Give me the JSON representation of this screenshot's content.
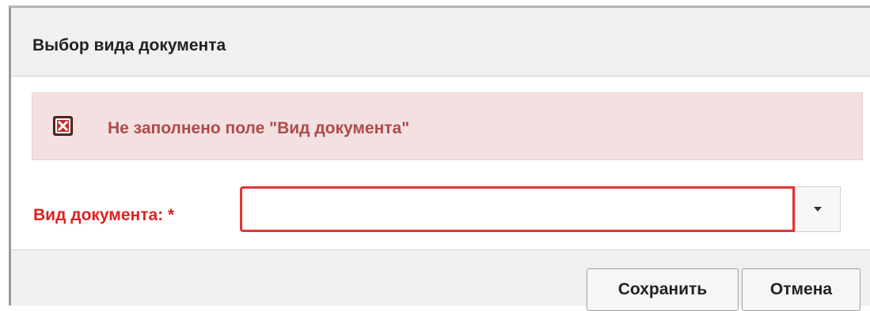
{
  "dialog": {
    "title": "Выбор вида документа",
    "error": {
      "icon": "error-x-icon",
      "message": "Не заполнено поле \"Вид документа\""
    },
    "field": {
      "label": "Вид документа: *",
      "value": "",
      "dropdown_icon": "caret-down-icon"
    },
    "buttons": {
      "save_label": "Сохранить",
      "cancel_label": "Отмена"
    }
  },
  "colors": {
    "error_text": "#b04a4a",
    "error_background": "#f3e0e0",
    "required_label": "#e02020",
    "invalid_border": "#e53232",
    "header_background": "#f0f0f0"
  }
}
